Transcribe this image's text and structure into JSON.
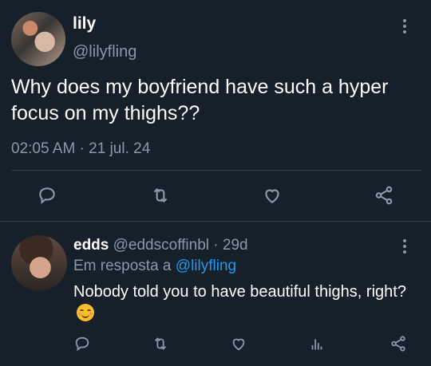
{
  "tweet": {
    "display_name": "lily",
    "handle": "@lilyfling",
    "text": "Why does my boyfriend have such a hyper focus on my thighs??",
    "timestamp": "02:05 AM · 21 jul. 24",
    "actions": [
      "reply-icon",
      "retweet-icon",
      "like-icon",
      "share-icon"
    ]
  },
  "reply": {
    "display_name": "edds",
    "handle": "@eddscoffinbl",
    "age": "· 29d",
    "in_reply_prefix": "Em resposta a",
    "in_reply_handle": "@lilyfling",
    "text": "Nobody told you to have beautiful thighs, right?",
    "emoji": "smiling-face-icon",
    "actions": [
      "reply-icon",
      "retweet-icon",
      "like-icon",
      "views-icon",
      "share-icon"
    ]
  },
  "colors": {
    "background": "#16202b",
    "text": "#ffffff",
    "muted": "#8b98a5",
    "link": "#1d9bf0",
    "divider": "#2f3b47"
  }
}
